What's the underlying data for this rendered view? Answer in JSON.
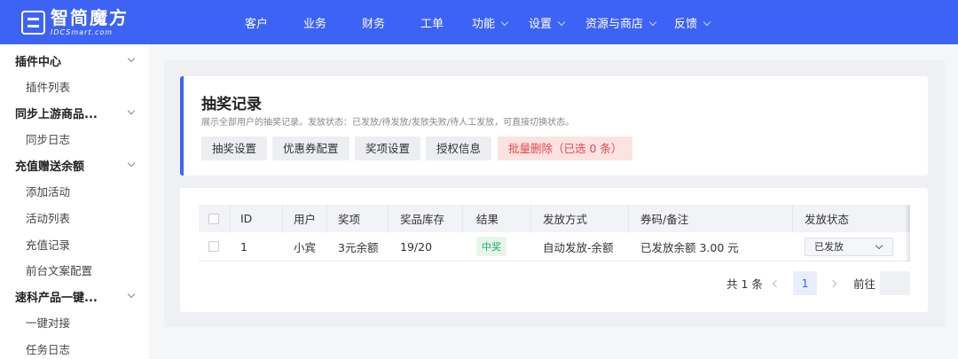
{
  "brand": {
    "name_cn": "智简魔方",
    "name_en": "IDCSmart.com"
  },
  "nav": [
    {
      "label": "客户",
      "dropdown": false
    },
    {
      "label": "业务",
      "dropdown": false
    },
    {
      "label": "财务",
      "dropdown": false
    },
    {
      "label": "工单",
      "dropdown": false
    },
    {
      "label": "功能",
      "dropdown": true
    },
    {
      "label": "设置",
      "dropdown": true
    },
    {
      "label": "资源与商店",
      "dropdown": true
    },
    {
      "label": "反馈",
      "dropdown": true
    }
  ],
  "sidebar": {
    "groups": [
      {
        "label": "插件中心",
        "items": [
          "插件列表"
        ]
      },
      {
        "label": "同步上游商品...",
        "items": [
          "同步日志"
        ]
      },
      {
        "label": "充值赠送余额",
        "items": [
          "添加活动",
          "活动列表",
          "充值记录",
          "前台文案配置"
        ]
      },
      {
        "label": "速科产品一键...",
        "items": [
          "一键对接",
          "任务日志"
        ]
      }
    ]
  },
  "page": {
    "title": "抽奖记录",
    "description": "展示全部用户的抽奖记录。发放状态：已发放/待发放/发放失败/待人工发放，可直接切换状态。",
    "buttons": [
      "抽奖设置",
      "优惠券配置",
      "奖项设置",
      "授权信息"
    ],
    "danger_button": "批量删除（已选 0 条）"
  },
  "table": {
    "columns": [
      "ID",
      "用户",
      "奖项",
      "奖品库存",
      "结果",
      "发放方式",
      "券码/备注",
      "发放状态"
    ],
    "rows": [
      {
        "id": "1",
        "user": "小宾",
        "prize": "3元余额",
        "stock": "19/20",
        "result": "中奖",
        "method": "自动发放-余额",
        "note": "已发放余额 3.00 元",
        "status": "已发放"
      }
    ]
  },
  "pagination": {
    "total": "共 1 条",
    "current": "1",
    "goto": "前往"
  },
  "colors": {
    "brand": "#3d63f5",
    "danger": "#e5484d",
    "success": "#25a85a"
  }
}
